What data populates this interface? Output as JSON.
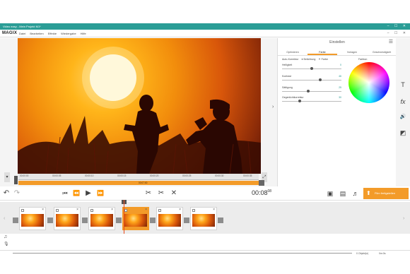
{
  "window": {
    "title": "Video easy - Mein Projekt M1*",
    "controls": "–  ☐  ✕"
  },
  "menubar": {
    "brand": "MAGIX",
    "items": [
      "Datei",
      "Bearbeiten",
      "Effekte",
      "Wiedergabe",
      "Hilfe"
    ],
    "window_controls": "–  ☐  ✕"
  },
  "preview": {
    "ruler_ticks": [
      "00:00:00",
      "00:00:05",
      "00:00:10",
      "00:00:15",
      "00:00:20",
      "00:00:25",
      "00:00:30",
      "00:00:35"
    ],
    "playbar_timecode": "00:07:00",
    "panel_toggle": "›"
  },
  "panel": {
    "title": "Einstellen",
    "menu_icon": "☰",
    "tabs": [
      "Optimieren",
      "Farbe",
      "Vorlagen",
      "Geschwindigkeit"
    ],
    "active_tab": 1,
    "auto_correction": {
      "label": "Auto-Korrektur",
      "option_1": "Belichtung",
      "option_2": "Farbe"
    },
    "controls": [
      {
        "label": "Helligkeit",
        "value": "0",
        "level": 0.5
      },
      {
        "label": "Kontrast",
        "value": "46",
        "level": 0.64
      },
      {
        "label": "Sättigung",
        "value": "25",
        "level": 0.44
      },
      {
        "label": "Gegenlichtkorrektur",
        "value": "30",
        "level": 0.3
      }
    ],
    "wheel_label": "Farbton"
  },
  "tools": [
    "T",
    "fx",
    "🔊",
    "◩"
  ],
  "transport": {
    "undo": "↶",
    "redo": "↷",
    "to_start": "⏮",
    "rewind": "⏪",
    "play": "▶",
    "forward": "⏩",
    "cut": "✂",
    "split": "✂",
    "delete": "✕",
    "timecode": "00:08",
    "timecode_frames": "08",
    "export_label": "Film fertigstellen",
    "export_icon": "⬆"
  },
  "storyboard": {
    "clips": [
      {
        "selected": false
      },
      {
        "selected": false
      },
      {
        "selected": false
      },
      {
        "selected": true
      },
      {
        "selected": false
      },
      {
        "selected": false
      }
    ],
    "left_arrow": "‹",
    "right_arrow": "›"
  },
  "audio": {
    "music_icon": "♫",
    "mic_icon": "🎙"
  },
  "status": {
    "left": "0 Objekt(e)",
    "right": "0m:0s"
  },
  "colors": {
    "accent": "#f39b29",
    "titlebar": "#2b9d96"
  }
}
